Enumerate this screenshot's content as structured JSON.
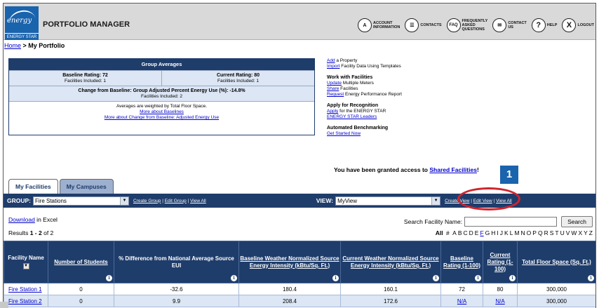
{
  "app": {
    "logo_script": "energy",
    "logo_band": "ENERGY STAR",
    "title": "PORTFOLIO MANAGER"
  },
  "nav": [
    {
      "icon": "account-icon",
      "glyph": "A",
      "label_1": "ACCOUNT",
      "label_2": "INFORMATION"
    },
    {
      "icon": "contacts-icon",
      "glyph": "☰",
      "label_1": "CONTACTS",
      "label_2": ""
    },
    {
      "icon": "faq-icon",
      "glyph": "FAQ",
      "label_1": "FREQUENTLY",
      "label_2": "ASKED",
      "label_3": "QUESTIONS"
    },
    {
      "icon": "contact-us-icon",
      "glyph": "✉",
      "label_1": "CONTACT",
      "label_2": "US"
    },
    {
      "icon": "help-icon",
      "glyph": "?",
      "label_1": "HELP",
      "label_2": ""
    },
    {
      "icon": "logout-icon",
      "glyph": "X",
      "label_1": "LOGOUT",
      "label_2": ""
    }
  ],
  "breadcrumb": {
    "home": "Home",
    "separator": " > ",
    "current": "My Portfolio"
  },
  "group_averages": {
    "title": "Group Averages",
    "baseline_label": "Baseline Rating: 72",
    "baseline_sub": "Facilities Included: 1",
    "current_label": "Current Rating: 80",
    "current_sub": "Facilities Included: 1",
    "change_label": "Change from Baseline: Group Adjusted Percent Energy Use (%): -14.8%",
    "change_sub": "Facilities Included: 2",
    "note": "Averages are weighted by Total Floor Space.",
    "link_baselines": "More about Baselines",
    "link_change": "More about Change from Baseline: Adjusted Energy Use"
  },
  "side_links": {
    "add_link": "Add",
    "add_text": " a Property",
    "import_link": "Import",
    "import_text": " Facility Data Using Templates",
    "work_heading": "Work with Facilities",
    "update_link": "Update",
    "update_text": " Multiple Meters",
    "share_link": "Share",
    "share_text": " Facilities",
    "request_link": "Request",
    "request_text": " Energy Performance Report",
    "apply_heading": "Apply for Recognition",
    "apply_link": "Apply",
    "apply_text": " for the ENERGY STAR",
    "leaders_link": "ENERGY STAR Leaders",
    "auto_heading": "Automated Benchmarking",
    "started_link": "Get Started Now",
    "access_text": "You have been granted access to ",
    "access_link": "Shared Facilities",
    "access_end": "!"
  },
  "callout_number": "1",
  "tabs": [
    "My Facilities",
    "My Campuses"
  ],
  "group_bar": {
    "group_label": "GROUP:",
    "group_value": "Fire Stations",
    "create_group": "Create Group",
    "edit_group": "Edit Group",
    "view_all": "View All",
    "view_label": "VIEW:",
    "view_value": "MyView",
    "create_view": "Create View",
    "edit_view": "Edit View",
    "view_all_2": "View All",
    "pipe": " | "
  },
  "download": {
    "link": "Download",
    "text": " in Excel"
  },
  "results": {
    "prefix": "Results ",
    "range": "1 - 2",
    "suffix": " of 2"
  },
  "search": {
    "label": "Search Facility Name:",
    "value": "",
    "button": "Search"
  },
  "alphabet": {
    "all": "All",
    "hash": "#",
    "letters": [
      "A",
      "B",
      "C",
      "D",
      "E",
      "F",
      "G",
      "H",
      "I",
      "J",
      "K",
      "L",
      "M",
      "N",
      "O",
      "P",
      "Q",
      "R",
      "S",
      "T",
      "U",
      "V",
      "W",
      "X",
      "Y",
      "Z"
    ],
    "linked": [
      "F"
    ]
  },
  "table": {
    "columns": [
      "Facility Name",
      "Number of Students",
      "% Difference from National Average Source EUI",
      "Baseline Weather Normalized Source Energy Intensity (kBtu/Sq. Ft.)",
      "Current Weather Normalized Source Energy Intensity (kBtu/Sq. Ft.)",
      "Baseline Rating (1-100)",
      "Current Rating (1-100)",
      "Total Floor Space (Sq. Ft.)"
    ],
    "rows": [
      [
        "Fire Station 1",
        "0",
        "-32.6",
        "180.4",
        "160.1",
        "72",
        "80",
        "300,000"
      ],
      [
        "Fire Station 2",
        "0",
        "9.9",
        "208.4",
        "172.6",
        "N/A",
        "N/A",
        "300,000"
      ]
    ]
  }
}
